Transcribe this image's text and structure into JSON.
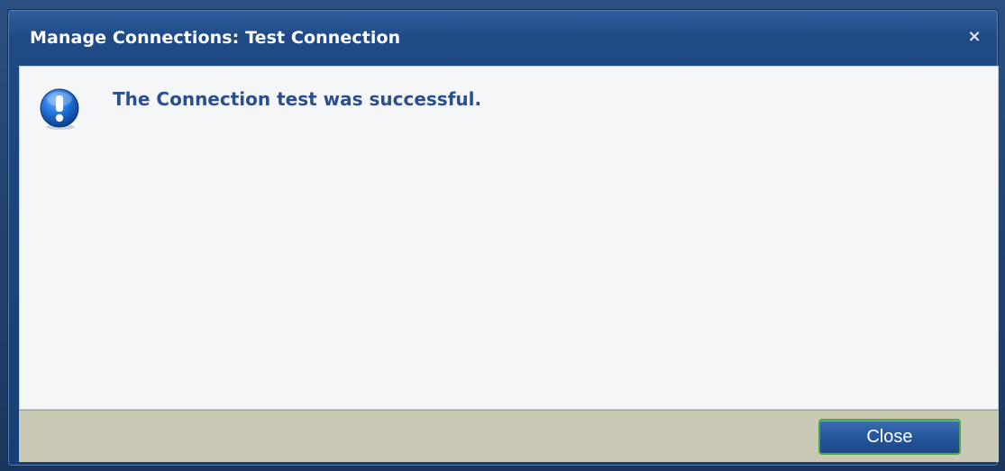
{
  "dialog": {
    "title": "Manage Connections: Test Connection",
    "close_glyph": "×",
    "close_icon": "close-icon",
    "message_icon": "info-exclamation-icon",
    "message": "The Connection test was successful.",
    "close_button_label": "Close"
  },
  "colors": {
    "titlebar": "#1f4a86",
    "message_text": "#2b4f8e",
    "footer": "#c9c9b6",
    "button": "#24569d",
    "button_border": "#4aa84a"
  }
}
